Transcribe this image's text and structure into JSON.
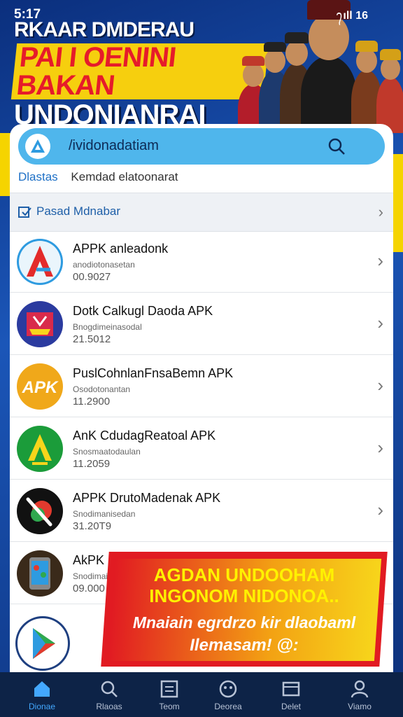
{
  "status_bar": {
    "time": "5:17",
    "right_text": "᭢ıll 16"
  },
  "banner": {
    "line1": "RKAAR DMDERAU",
    "line2": "PAI I OENINI BAKAN",
    "line3": "UNDONIANRAI"
  },
  "search": {
    "query": "/ividonadatiam"
  },
  "tabs": {
    "primary": "Dlastas",
    "secondary": "Kemdad elatoonarat"
  },
  "section": {
    "label": "Pasad Mdnabar",
    "chevron": "›"
  },
  "apps": [
    {
      "name": "APPK anleadonk",
      "sub": "anodiotonasetan",
      "version": "00.9027",
      "icon": "a-logo-icon",
      "color": "#2e9be0"
    },
    {
      "name": "Dotk Calkugl Daoda APK",
      "sub": "Bnogdimeinasodal",
      "version": "21.5012",
      "icon": "ship-logo-icon",
      "color": "#2b3b9f"
    },
    {
      "name": "PuslCohnlanFnsaBemn APK",
      "sub": "Osodotonantan",
      "version": "11.2900",
      "icon": "apk-text-icon",
      "color": "#f0a81a"
    },
    {
      "name": "AnK CdudagReatoal APK",
      "sub": "Snosmaatodaulan",
      "version": "11.2059",
      "icon": "green-a-icon",
      "color": "#1b9c3a"
    },
    {
      "name": "APPK DrutoMadenak APK",
      "sub": "Snodimanisedan",
      "version": "31.20T9",
      "icon": "slash-circle-icon",
      "color": "#111111"
    },
    {
      "name": "AkPK Dr",
      "sub": "Snodimaisodan",
      "version": "09.000",
      "icon": "phone-app-icon",
      "color": "#3a2a1a"
    }
  ],
  "promo": {
    "line1": "AGDAN UNDOOHAM",
    "line2": "INGONOM NIDONOA..",
    "line3": "Mnaiain egrdrzo kir dlaobaml",
    "line4": "Ilemasam! @:"
  },
  "nav": [
    {
      "label": "Dionae",
      "icon": "home-icon",
      "active": true
    },
    {
      "label": "Rlaoas",
      "icon": "search-icon",
      "active": false
    },
    {
      "label": "Teom",
      "icon": "document-icon",
      "active": false
    },
    {
      "label": "Deorea",
      "icon": "chat-icon",
      "active": false
    },
    {
      "label": "Delet",
      "icon": "folder-icon",
      "active": false
    },
    {
      "label": "Viamo",
      "icon": "profile-icon",
      "active": false
    }
  ]
}
